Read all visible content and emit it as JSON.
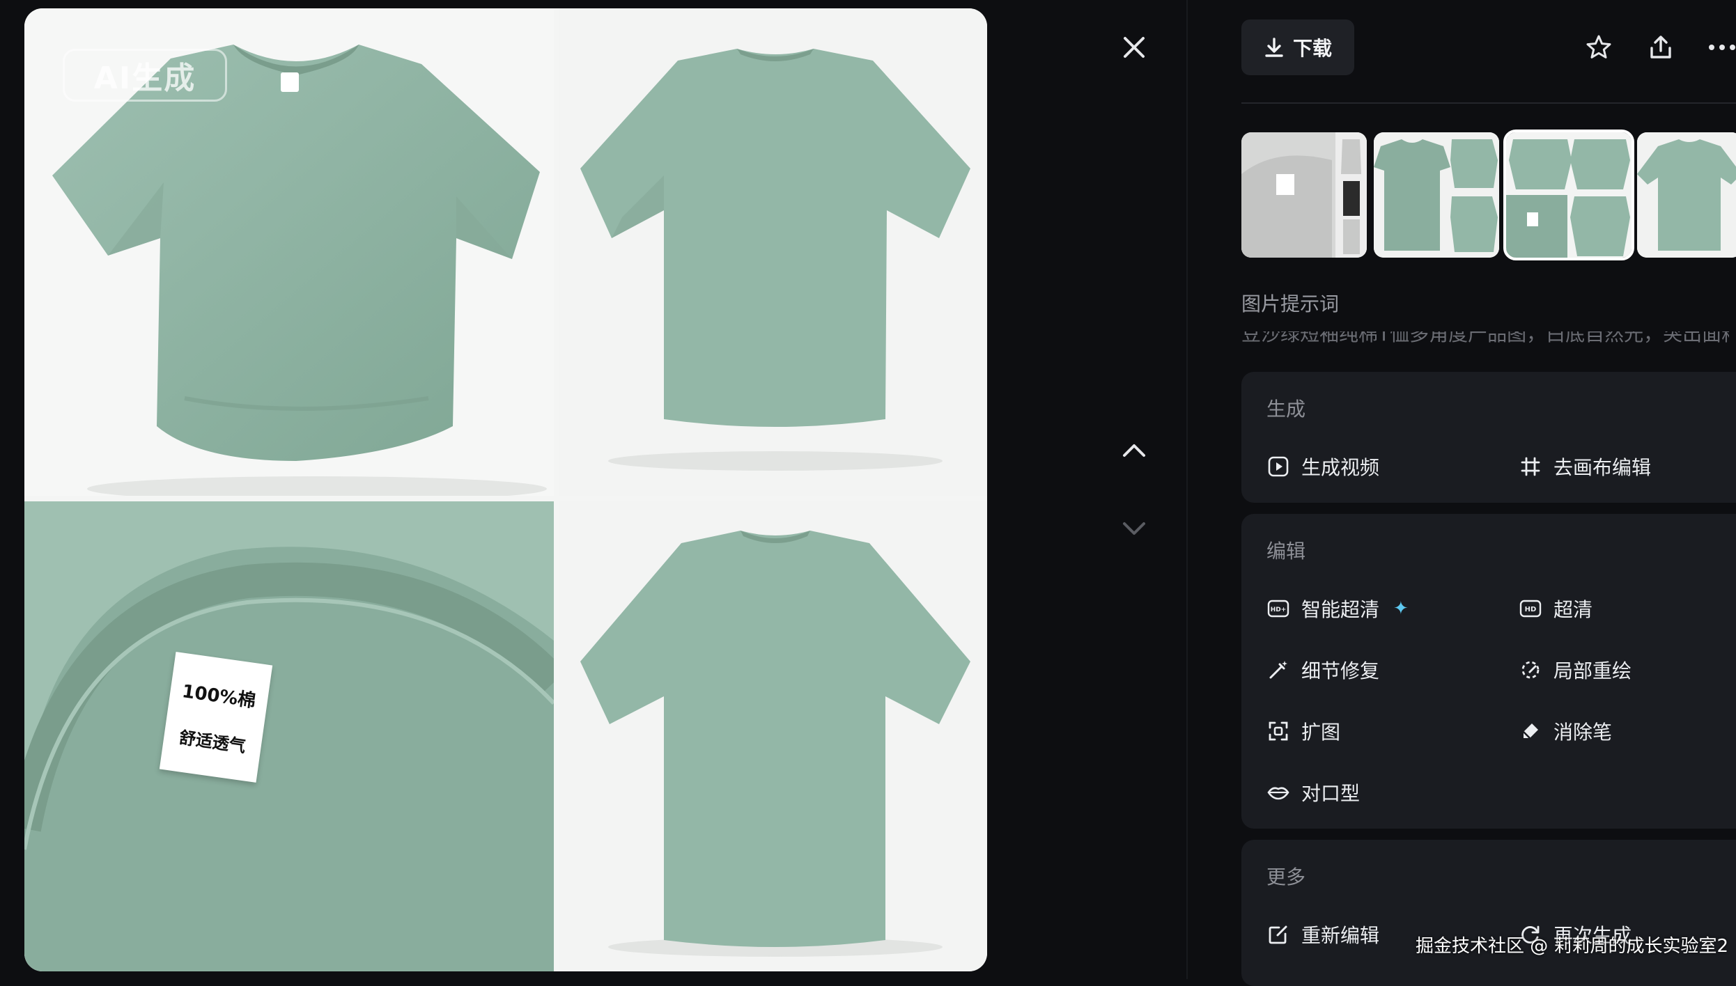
{
  "image": {
    "watermark": "AI生成",
    "label_lines": [
      "100%棉",
      "舒适透气"
    ]
  },
  "nav": {
    "close_icon": "close-icon",
    "prev_icon": "chevron-up-icon",
    "next_icon": "chevron-down-icon"
  },
  "toolbar": {
    "download_label": "下载",
    "favorite_icon": "star-icon",
    "share_icon": "share-icon",
    "more_icon": "more-icon"
  },
  "thumbnails": [
    {
      "name": "thumbnail-1",
      "active": false
    },
    {
      "name": "thumbnail-2",
      "active": false
    },
    {
      "name": "thumbnail-3",
      "active": true
    },
    {
      "name": "thumbnail-4",
      "active": false
    }
  ],
  "prompt": {
    "title": "图片提示词",
    "text": "豆沙绿短袖纯棉T恤多角度产品图，白底自然光，突出面料纹理与标签文字"
  },
  "sections": {
    "generate": {
      "title": "生成",
      "items": [
        "生成视频",
        "去画布编辑"
      ]
    },
    "edit": {
      "title": "编辑",
      "items": [
        "智能超清",
        "超清",
        "细节修复",
        "局部重绘",
        "扩图",
        "消除笔",
        "对口型"
      ],
      "sparkle": "✦"
    },
    "more": {
      "title": "更多",
      "items": [
        "重新编辑",
        "再次生成"
      ]
    }
  },
  "credit": "掘金技术社区 @ 莉莉周的成长实验室2",
  "colors": {
    "background": "#0d0e11",
    "panel": "#1a1c21",
    "shirt": "#8fb3a3",
    "accent": "#5ec8f0"
  }
}
